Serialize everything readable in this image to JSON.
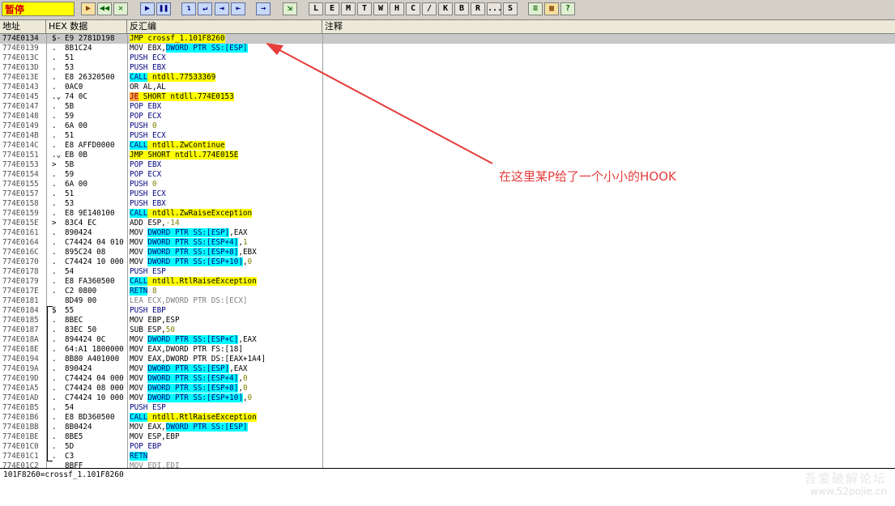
{
  "toolbar": {
    "status": "暂停",
    "buttons": [
      "▶",
      "◀◀",
      "✕",
      "▶",
      "❚❚",
      "↴",
      "↵",
      "⇥",
      "⇤",
      "→",
      "⇲",
      "L",
      "E",
      "M",
      "T",
      "W",
      "H",
      "C",
      "/",
      "K",
      "B",
      "R",
      "...",
      "S",
      "≡",
      "▦",
      "?"
    ]
  },
  "columns": {
    "address": "地址",
    "hex": "HEX 数据",
    "disasm": "反汇编",
    "comment": "注释"
  },
  "rows": [
    {
      "addr": "774E0134",
      "mark": "$-",
      "hex": "E9 2781D198",
      "asm": [
        [
          "hl-y",
          "JMP crossf_1.101F8260"
        ]
      ],
      "sel": true
    },
    {
      "addr": "774E0139",
      "mark": ".",
      "hex": "8B1C24",
      "asm": [
        [
          "",
          "MOV EBX,"
        ],
        [
          "hl-c",
          "DWORD PTR SS:[ESP]"
        ]
      ]
    },
    {
      "addr": "774E013C",
      "mark": ".",
      "hex": "51",
      "asm": [
        [
          "c-blue",
          "PUSH ECX"
        ]
      ]
    },
    {
      "addr": "774E013D",
      "mark": ".",
      "hex": "53",
      "asm": [
        [
          "c-blue",
          "PUSH EBX"
        ]
      ]
    },
    {
      "addr": "774E013E",
      "mark": ".",
      "hex": "E8 26320500",
      "asm": [
        [
          "hl-c",
          "CALL"
        ],
        [
          "hl-y",
          " ntdll.77533369"
        ]
      ]
    },
    {
      "addr": "774E0143",
      "mark": ".",
      "hex": "0AC0",
      "asm": [
        [
          "",
          "OR AL,AL"
        ]
      ]
    },
    {
      "addr": "774E0145",
      "mark": ".⌄",
      "hex": "74 0C",
      "asm": [
        [
          "hl-o",
          "JE"
        ],
        [
          "hl-y",
          " SHORT ntdll.774E0153"
        ]
      ]
    },
    {
      "addr": "774E0147",
      "mark": ".",
      "hex": "5B",
      "asm": [
        [
          "c-blue",
          "POP EBX"
        ]
      ]
    },
    {
      "addr": "774E0148",
      "mark": ".",
      "hex": "59",
      "asm": [
        [
          "c-blue",
          "POP ECX"
        ]
      ]
    },
    {
      "addr": "774E0149",
      "mark": ".",
      "hex": "6A 00",
      "asm": [
        [
          "c-blue",
          "PUSH "
        ],
        [
          "num",
          "0"
        ]
      ]
    },
    {
      "addr": "774E014B",
      "mark": ".",
      "hex": "51",
      "asm": [
        [
          "c-blue",
          "PUSH ECX"
        ]
      ]
    },
    {
      "addr": "774E014C",
      "mark": ".",
      "hex": "E8 AFFD0000",
      "asm": [
        [
          "hl-c",
          "CALL"
        ],
        [
          "hl-y",
          " ntdll.ZwContinue"
        ]
      ]
    },
    {
      "addr": "774E0151",
      "mark": ".⌄",
      "hex": "EB 0B",
      "asm": [
        [
          "hl-y",
          "JMP SHORT ntdll.774E015E"
        ]
      ]
    },
    {
      "addr": "774E0153",
      "mark": ">",
      "hex": "5B",
      "asm": [
        [
          "c-blue",
          "POP EBX"
        ]
      ]
    },
    {
      "addr": "774E0154",
      "mark": ".",
      "hex": "59",
      "asm": [
        [
          "c-blue",
          "POP ECX"
        ]
      ]
    },
    {
      "addr": "774E0155",
      "mark": ".",
      "hex": "6A 00",
      "asm": [
        [
          "c-blue",
          "PUSH "
        ],
        [
          "num",
          "0"
        ]
      ]
    },
    {
      "addr": "774E0157",
      "mark": ".",
      "hex": "51",
      "asm": [
        [
          "c-blue",
          "PUSH ECX"
        ]
      ]
    },
    {
      "addr": "774E0158",
      "mark": ".",
      "hex": "53",
      "asm": [
        [
          "c-blue",
          "PUSH EBX"
        ]
      ]
    },
    {
      "addr": "774E0159",
      "mark": ".",
      "hex": "E8 9E140100",
      "asm": [
        [
          "hl-c",
          "CALL"
        ],
        [
          "hl-y",
          " ntdll.ZwRaiseException"
        ]
      ]
    },
    {
      "addr": "774E015E",
      "mark": ">",
      "hex": "83C4 EC",
      "asm": [
        [
          "",
          "ADD ESP,"
        ],
        [
          "num",
          "-14"
        ]
      ]
    },
    {
      "addr": "774E0161",
      "mark": ".",
      "hex": "890424",
      "asm": [
        [
          "",
          "MOV "
        ],
        [
          "hl-c",
          "DWORD PTR SS:[ESP]"
        ],
        [
          "",
          ",EAX"
        ]
      ]
    },
    {
      "addr": "774E0164",
      "mark": ".",
      "hex": "C74424 04 010",
      "asm": [
        [
          "",
          "MOV "
        ],
        [
          "hl-c",
          "DWORD PTR SS:[ESP+4]"
        ],
        [
          "",
          ","
        ],
        [
          "num",
          "1"
        ]
      ]
    },
    {
      "addr": "774E016C",
      "mark": ".",
      "hex": "895C24 08",
      "asm": [
        [
          "",
          "MOV "
        ],
        [
          "hl-c",
          "DWORD PTR SS:[ESP+8]"
        ],
        [
          "",
          ",EBX"
        ]
      ]
    },
    {
      "addr": "774E0170",
      "mark": ".",
      "hex": "C74424 10 000",
      "asm": [
        [
          "",
          "MOV "
        ],
        [
          "hl-c",
          "DWORD PTR SS:[ESP+10]"
        ],
        [
          "",
          ","
        ],
        [
          "num",
          "0"
        ]
      ]
    },
    {
      "addr": "774E0178",
      "mark": ".",
      "hex": "54",
      "asm": [
        [
          "c-blue",
          "PUSH ESP"
        ]
      ]
    },
    {
      "addr": "774E0179",
      "mark": ".",
      "hex": "E8 FA360500",
      "asm": [
        [
          "hl-c",
          "CALL"
        ],
        [
          "hl-y",
          " ntdll.RtlRaiseException"
        ]
      ]
    },
    {
      "addr": "774E017E",
      "mark": ".",
      "hex": "C2 0800",
      "asm": [
        [
          "hl-c",
          "RETN"
        ],
        [
          "num",
          " 8"
        ]
      ]
    },
    {
      "addr": "774E0181",
      "mark": "",
      "hex": "8D49 00",
      "asm": [
        [
          "gray",
          "LEA ECX,DWORD PTR DS:[ECX]"
        ]
      ]
    },
    {
      "addr": "774E0184",
      "mark": "$",
      "hex": "55",
      "asm": [
        [
          "c-blue",
          "PUSH EBP"
        ]
      ]
    },
    {
      "addr": "774E0185",
      "mark": ".",
      "hex": "8BEC",
      "asm": [
        [
          "",
          "MOV EBP,ESP"
        ]
      ]
    },
    {
      "addr": "774E0187",
      "mark": ".",
      "hex": "83EC 50",
      "asm": [
        [
          "",
          "SUB ESP,"
        ],
        [
          "num",
          "50"
        ]
      ]
    },
    {
      "addr": "774E018A",
      "mark": ".",
      "hex": "894424 0C",
      "asm": [
        [
          "",
          "MOV "
        ],
        [
          "hl-c",
          "DWORD PTR SS:[ESP+C]"
        ],
        [
          "",
          ",EAX"
        ]
      ]
    },
    {
      "addr": "774E018E",
      "mark": ".",
      "hex": "64:A1 1800000",
      "asm": [
        [
          "",
          "MOV EAX,DWORD PTR FS:[18]"
        ]
      ]
    },
    {
      "addr": "774E0194",
      "mark": ".",
      "hex": "8B80 A401000",
      "asm": [
        [
          "",
          "MOV EAX,DWORD PTR DS:[EAX+1A4]"
        ]
      ]
    },
    {
      "addr": "774E019A",
      "mark": ".",
      "hex": "890424",
      "asm": [
        [
          "",
          "MOV "
        ],
        [
          "hl-c",
          "DWORD PTR SS:[ESP]"
        ],
        [
          "",
          ",EAX"
        ]
      ]
    },
    {
      "addr": "774E019D",
      "mark": ".",
      "hex": "C74424 04 000",
      "asm": [
        [
          "",
          "MOV "
        ],
        [
          "hl-c",
          "DWORD PTR SS:[ESP+4]"
        ],
        [
          "",
          ","
        ],
        [
          "num",
          "0"
        ]
      ]
    },
    {
      "addr": "774E01A5",
      "mark": ".",
      "hex": "C74424 08 000",
      "asm": [
        [
          "",
          "MOV "
        ],
        [
          "hl-c",
          "DWORD PTR SS:[ESP+8]"
        ],
        [
          "",
          ","
        ],
        [
          "num",
          "0"
        ]
      ]
    },
    {
      "addr": "774E01AD",
      "mark": ".",
      "hex": "C74424 10 000",
      "asm": [
        [
          "",
          "MOV "
        ],
        [
          "hl-c",
          "DWORD PTR SS:[ESP+10]"
        ],
        [
          "",
          ","
        ],
        [
          "num",
          "0"
        ]
      ]
    },
    {
      "addr": "774E01B5",
      "mark": ".",
      "hex": "54",
      "asm": [
        [
          "c-blue",
          "PUSH ESP"
        ]
      ]
    },
    {
      "addr": "774E01B6",
      "mark": ".",
      "hex": "E8 BD360500",
      "asm": [
        [
          "hl-c",
          "CALL"
        ],
        [
          "hl-y",
          " ntdll.RtlRaiseException"
        ]
      ]
    },
    {
      "addr": "774E01BB",
      "mark": ".",
      "hex": "8B0424",
      "asm": [
        [
          "",
          "MOV EAX,"
        ],
        [
          "hl-c",
          "DWORD PTR SS:[ESP]"
        ]
      ]
    },
    {
      "addr": "774E01BE",
      "mark": ".",
      "hex": "8BE5",
      "asm": [
        [
          "",
          "MOV ESP,EBP"
        ]
      ]
    },
    {
      "addr": "774E01C0",
      "mark": ".",
      "hex": "5D",
      "asm": [
        [
          "c-blue",
          "POP EBP"
        ]
      ]
    },
    {
      "addr": "774E01C1",
      "mark": ".",
      "hex": "C3",
      "asm": [
        [
          "hl-c",
          "RETN"
        ]
      ]
    },
    {
      "addr": "774E01C2",
      "mark": "",
      "hex": "8BFF",
      "asm": [
        [
          "gray",
          "MOV EDI,EDI"
        ]
      ]
    }
  ],
  "info_line": "101F8260=crossf_1.101F8260",
  "annotation": "在这里某P给了一个小小的HOOK",
  "watermark": {
    "line1": "吾爱破解论坛",
    "line2": "www.52pojie.cn"
  },
  "colors": {
    "annotation": "#e63c3c",
    "toolbar": "#d4d0c8",
    "selection": "#c8c8c8"
  }
}
